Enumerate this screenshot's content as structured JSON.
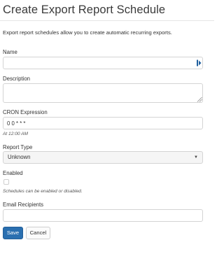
{
  "page": {
    "title": "Create Export Report Schedule",
    "intro": "Export report schedules allow you to create automatic recurring exports."
  },
  "form": {
    "name": {
      "label": "Name",
      "value": "",
      "adornment_icon": "password-manager-icon"
    },
    "description": {
      "label": "Description",
      "value": ""
    },
    "cron": {
      "label": "CRON Expression",
      "value": "0 0 * * *",
      "help": "At 12:00 AM"
    },
    "report_type": {
      "label": "Report Type",
      "selected": "Unknown"
    },
    "enabled": {
      "label": "Enabled",
      "checked": false,
      "help": "Schedules can be enabled or disabled."
    },
    "email_recipients": {
      "label": "Email Recipients",
      "value": ""
    }
  },
  "buttons": {
    "save": "Save",
    "cancel": "Cancel"
  },
  "colors": {
    "primary_button": "#2a6fb0",
    "adornment_icon": "#1f5f9e"
  }
}
